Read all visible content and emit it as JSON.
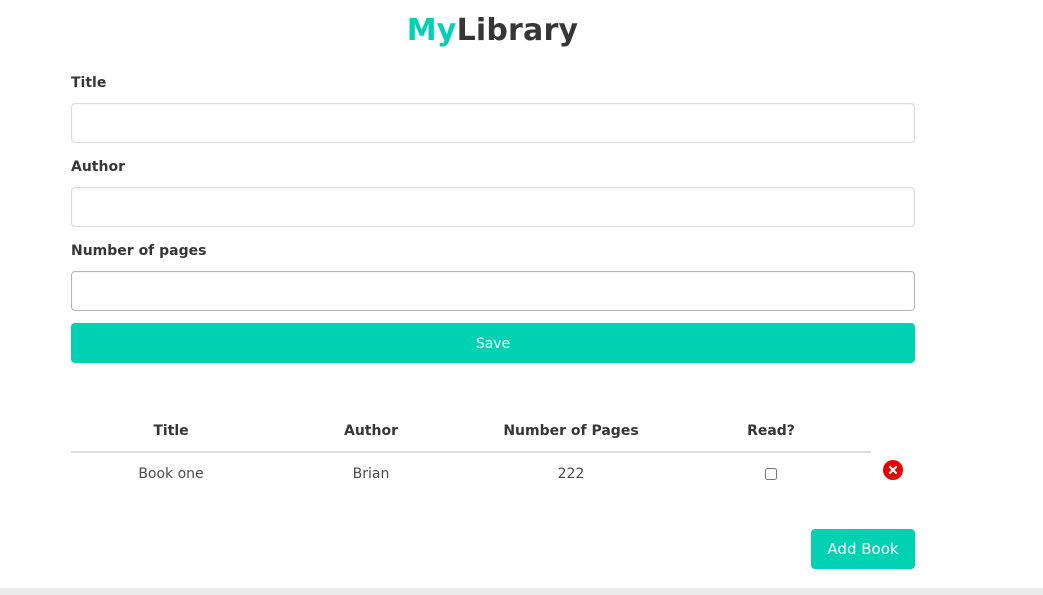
{
  "header": {
    "title_accent": "My",
    "title_rest": "Library",
    "accent_color": "#00d1b2"
  },
  "form": {
    "title_label": "Title",
    "title_value": "",
    "author_label": "Author",
    "author_value": "",
    "pages_label": "Number of pages",
    "pages_value": "",
    "save_label": "Save"
  },
  "table": {
    "columns": [
      "Title",
      "Author",
      "Number of Pages",
      "Read?"
    ],
    "rows": [
      {
        "title": "Book one",
        "author": "Brian",
        "pages": "222",
        "read": false
      }
    ]
  },
  "actions": {
    "delete_icon": "close-circle-icon",
    "delete_color": "#e60000",
    "add_book_label": "Add Book"
  }
}
